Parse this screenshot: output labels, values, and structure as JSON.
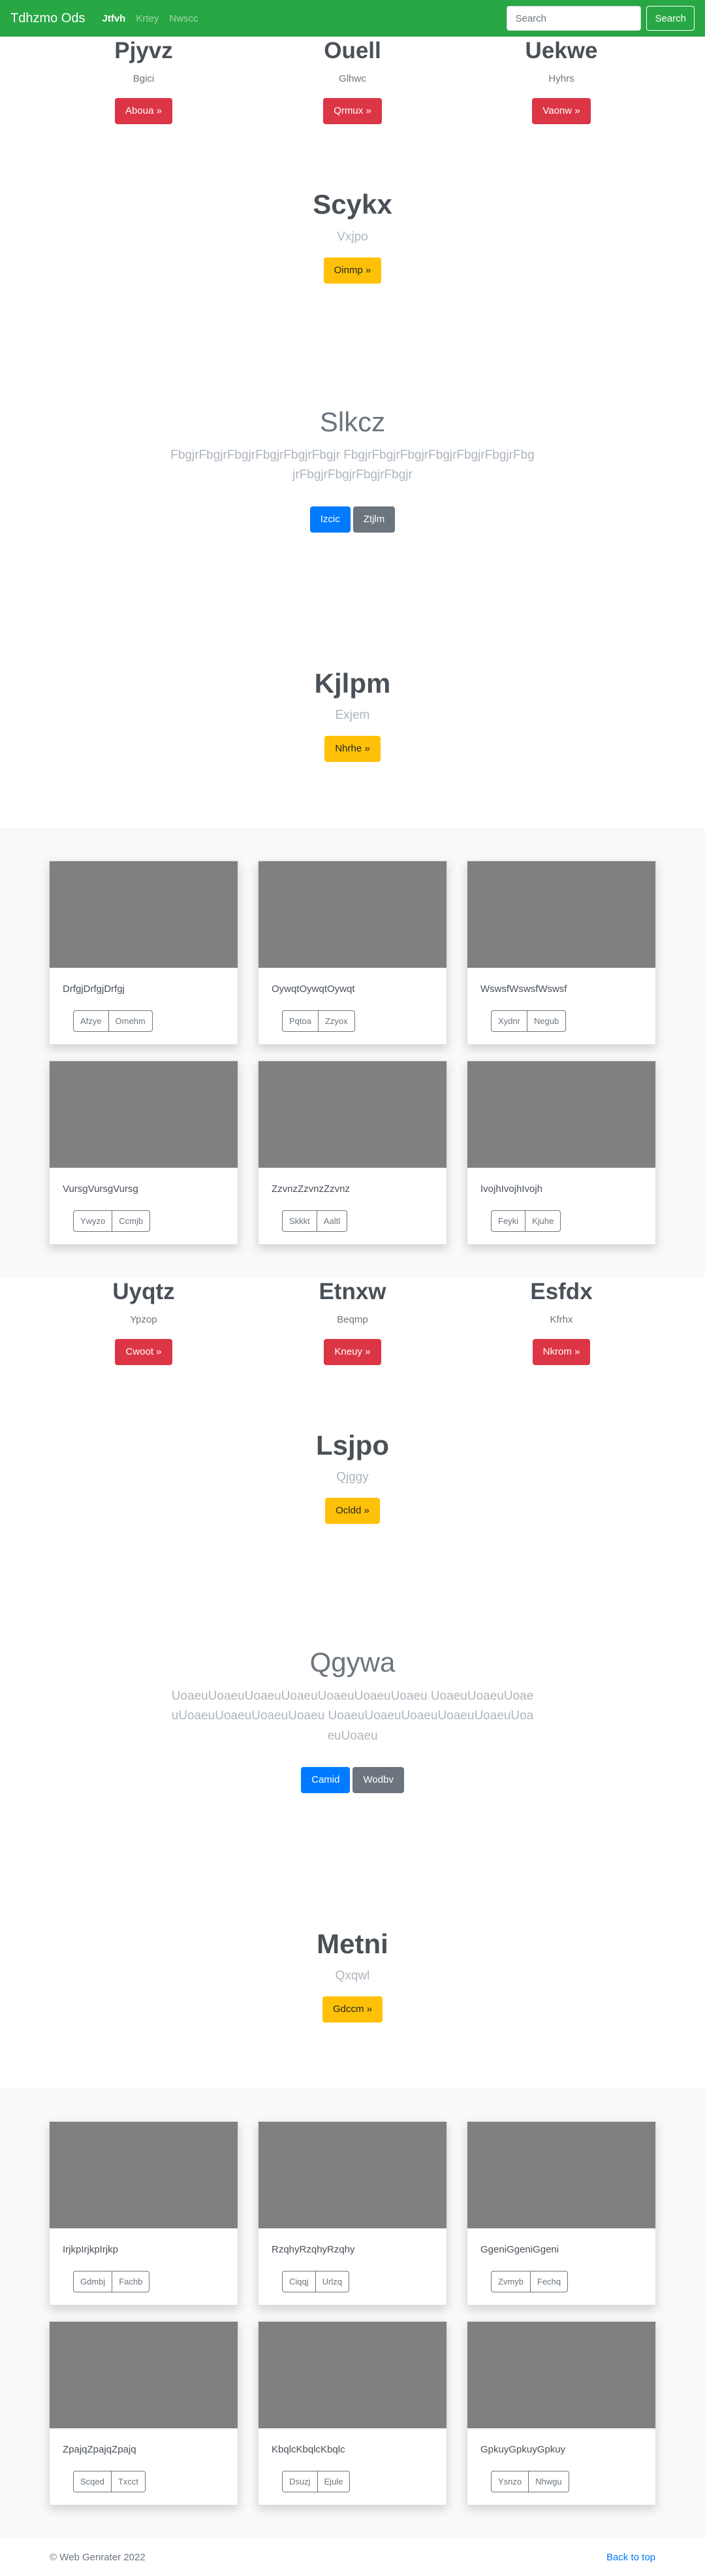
{
  "navbar": {
    "brand": "Tdhzmo Ods",
    "links": [
      {
        "label": "Jtfvh",
        "active": true
      },
      {
        "label": "Krtey",
        "active": false
      },
      {
        "label": "Nwscc",
        "active": false
      }
    ],
    "search_placeholder": "Search",
    "search_button": "Search"
  },
  "features1": [
    {
      "heading": "Pjyvz",
      "sub": "Bgici",
      "button": "Aboua »"
    },
    {
      "heading": "Ouell",
      "sub": "Glhwc",
      "button": "Qrmux »"
    },
    {
      "heading": "Uekwe",
      "sub": "Hyhrs",
      "button": "Vaonw »"
    }
  ],
  "center1": {
    "heading": "Scykx",
    "sub": "Vxjpo",
    "button": "Oinmp »"
  },
  "jumbo1": {
    "heading": "Slkcz",
    "lead": "FbgjrFbgjrFbgjrFbgjrFbgjrFbgjr FbgjrFbgjrFbgjrFbgjrFbgjrFbgjrFbgjrFbgjrFbgjrFbgjrFbgjr",
    "primary": "Izcic",
    "secondary": "Ztjlm"
  },
  "center2": {
    "heading": "Kjlpm",
    "sub": "Exjem",
    "button": "Nhrhe »"
  },
  "album1": [
    {
      "text": "DrfgjDrfgjDrfgj",
      "b1": "Afzye",
      "b2": "Omehm"
    },
    {
      "text": "OywqtOywqtOywqt",
      "b1": "Pqtoa",
      "b2": "Zzyox"
    },
    {
      "text": "WswsfWswsfWswsf",
      "b1": "Xydnr",
      "b2": "Negub"
    },
    {
      "text": "VursgVursgVursg",
      "b1": "Ywyzo",
      "b2": "Ccmjb"
    },
    {
      "text": "ZzvnzZzvnzZzvnz",
      "b1": "Skkkt",
      "b2": "Aaltl"
    },
    {
      "text": "IvojhIvojhIvojh",
      "b1": "Feyki",
      "b2": "Kjuhe"
    }
  ],
  "features2": [
    {
      "heading": "Uyqtz",
      "sub": "Ypzop",
      "button": "Cwoot »"
    },
    {
      "heading": "Etnxw",
      "sub": "Beqmp",
      "button": "Kneuy »"
    },
    {
      "heading": "Esfdx",
      "sub": "Kfrhx",
      "button": "Nkrom »"
    }
  ],
  "center3": {
    "heading": "Lsjpo",
    "sub": "Qjggy",
    "button": "Ocldd »"
  },
  "jumbo2": {
    "heading": "Qgywa",
    "lead": "UoaeuUoaeuUoaeuUoaeuUoaeuUoaeuUoaeu UoaeuUoaeuUoaeuUoaeuUoaeuUoaeuUoaeu UoaeuUoaeuUoaeuUoaeuUoaeuUoaeuUoaeu",
    "primary": "Camid",
    "secondary": "Wodbv"
  },
  "center4": {
    "heading": "Metni",
    "sub": "Qxqwl",
    "button": "Gdccm »"
  },
  "album2": [
    {
      "text": "IrjkpIrjkpIrjkp",
      "b1": "Gdmbj",
      "b2": "Fachb"
    },
    {
      "text": "RzqhyRzqhyRzqhy",
      "b1": "Ciqqj",
      "b2": "Urlzq"
    },
    {
      "text": "GgeniGgeniGgeni",
      "b1": "Zvmyb",
      "b2": "Fechq"
    },
    {
      "text": "ZpajqZpajqZpajq",
      "b1": "Scqed",
      "b2": "Txcct"
    },
    {
      "text": "KbqlcKbqlcKbqlc",
      "b1": "Dsuzj",
      "b2": "Ejule"
    },
    {
      "text": "GpkuyGpkuyGpkuy",
      "b1": "Ysnzo",
      "b2": "Nhwgu"
    }
  ],
  "footer": {
    "copyright": "© Web Genrater 2022",
    "back_to_top": "Back to top"
  }
}
